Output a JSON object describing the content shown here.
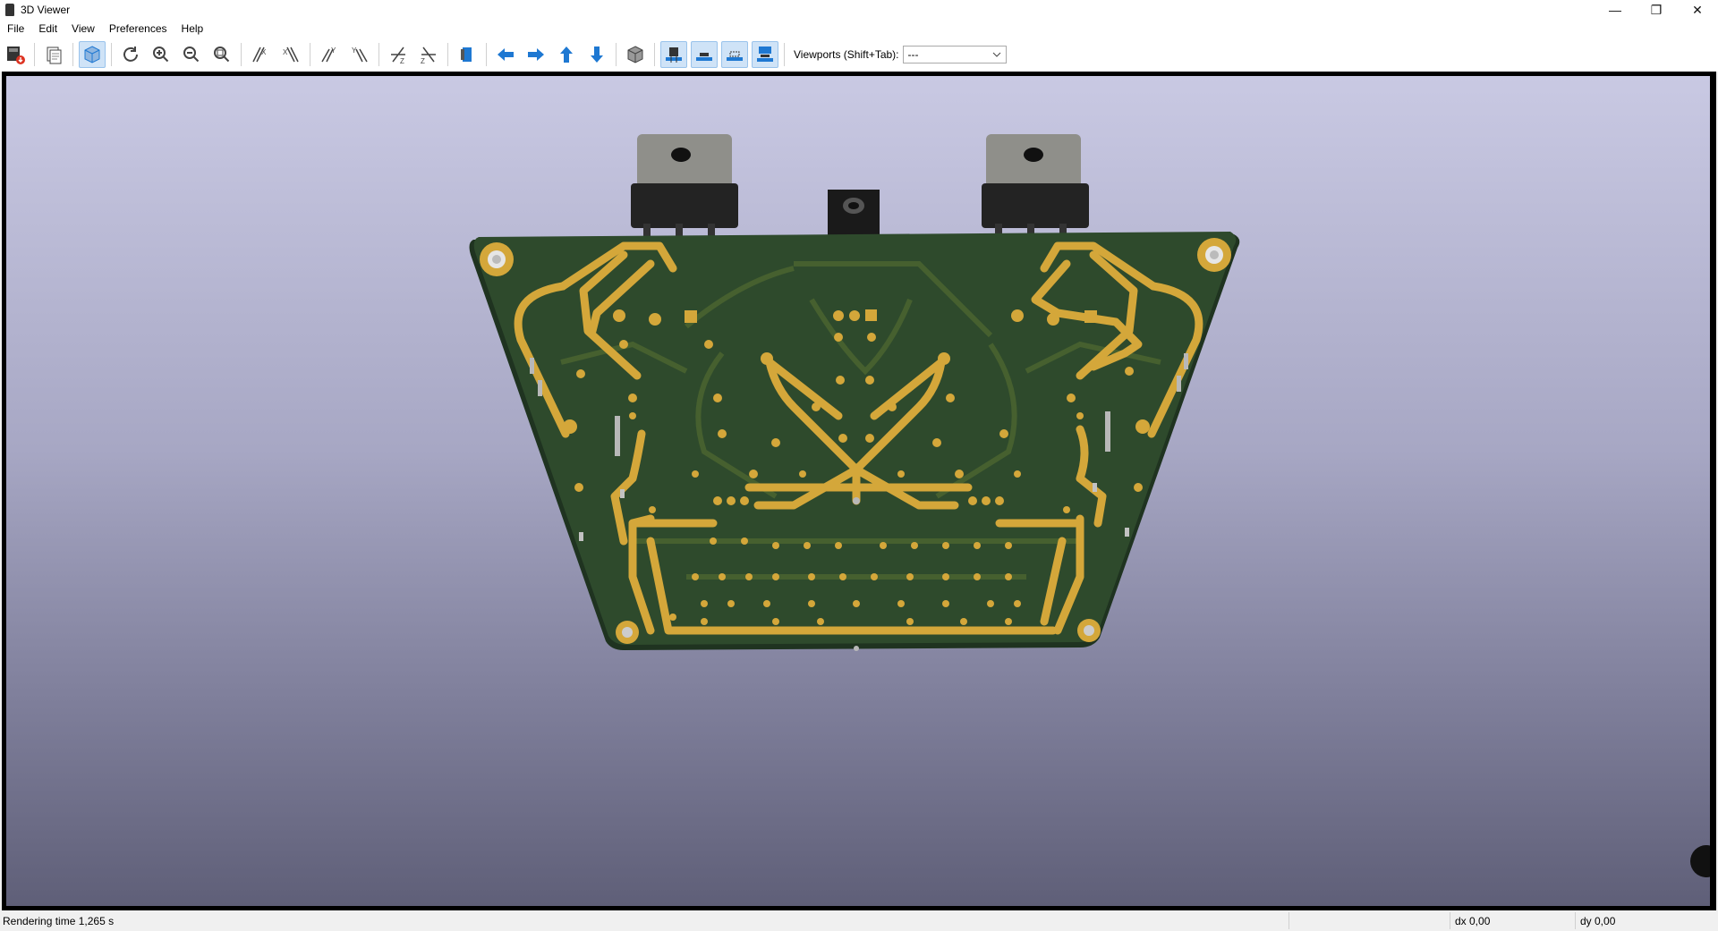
{
  "window": {
    "title": "3D Viewer",
    "controls": {
      "minimize": "—",
      "restore": "❐",
      "close": "✕"
    }
  },
  "menu": [
    "File",
    "Edit",
    "View",
    "Preferences",
    "Help"
  ],
  "toolbar": {
    "viewports_label": "Viewports (Shift+Tab):",
    "viewports_value": "---",
    "icons": [
      "export-image-icon",
      "copy-image-icon",
      "raytrace-view-icon",
      "reload-icon",
      "zoom-in-icon",
      "zoom-out-icon",
      "zoom-fit-icon",
      "rotate-x-cw-icon",
      "rotate-x-ccw-icon",
      "rotate-y-cw-icon",
      "rotate-y-ccw-icon",
      "rotate-z-cw-icon",
      "rotate-z-ccw-icon",
      "flip-board-icon",
      "pan-left-icon",
      "pan-right-icon",
      "pan-up-icon",
      "pan-down-icon",
      "orthographic-icon",
      "show-tht-icon",
      "show-smd-icon",
      "show-virtual-icon",
      "show-not-in-posfile-icon"
    ]
  },
  "colors": {
    "accent": "#1e78d2",
    "pcb": "#2f4a2c",
    "copper": "#d4a73a",
    "background_top": "#c9c9e3",
    "background_bottom": "#5f5f78"
  },
  "status": {
    "render_time": "Rendering time 1,265 s",
    "dx": "dx 0,00",
    "dy": "dy 0,00"
  }
}
